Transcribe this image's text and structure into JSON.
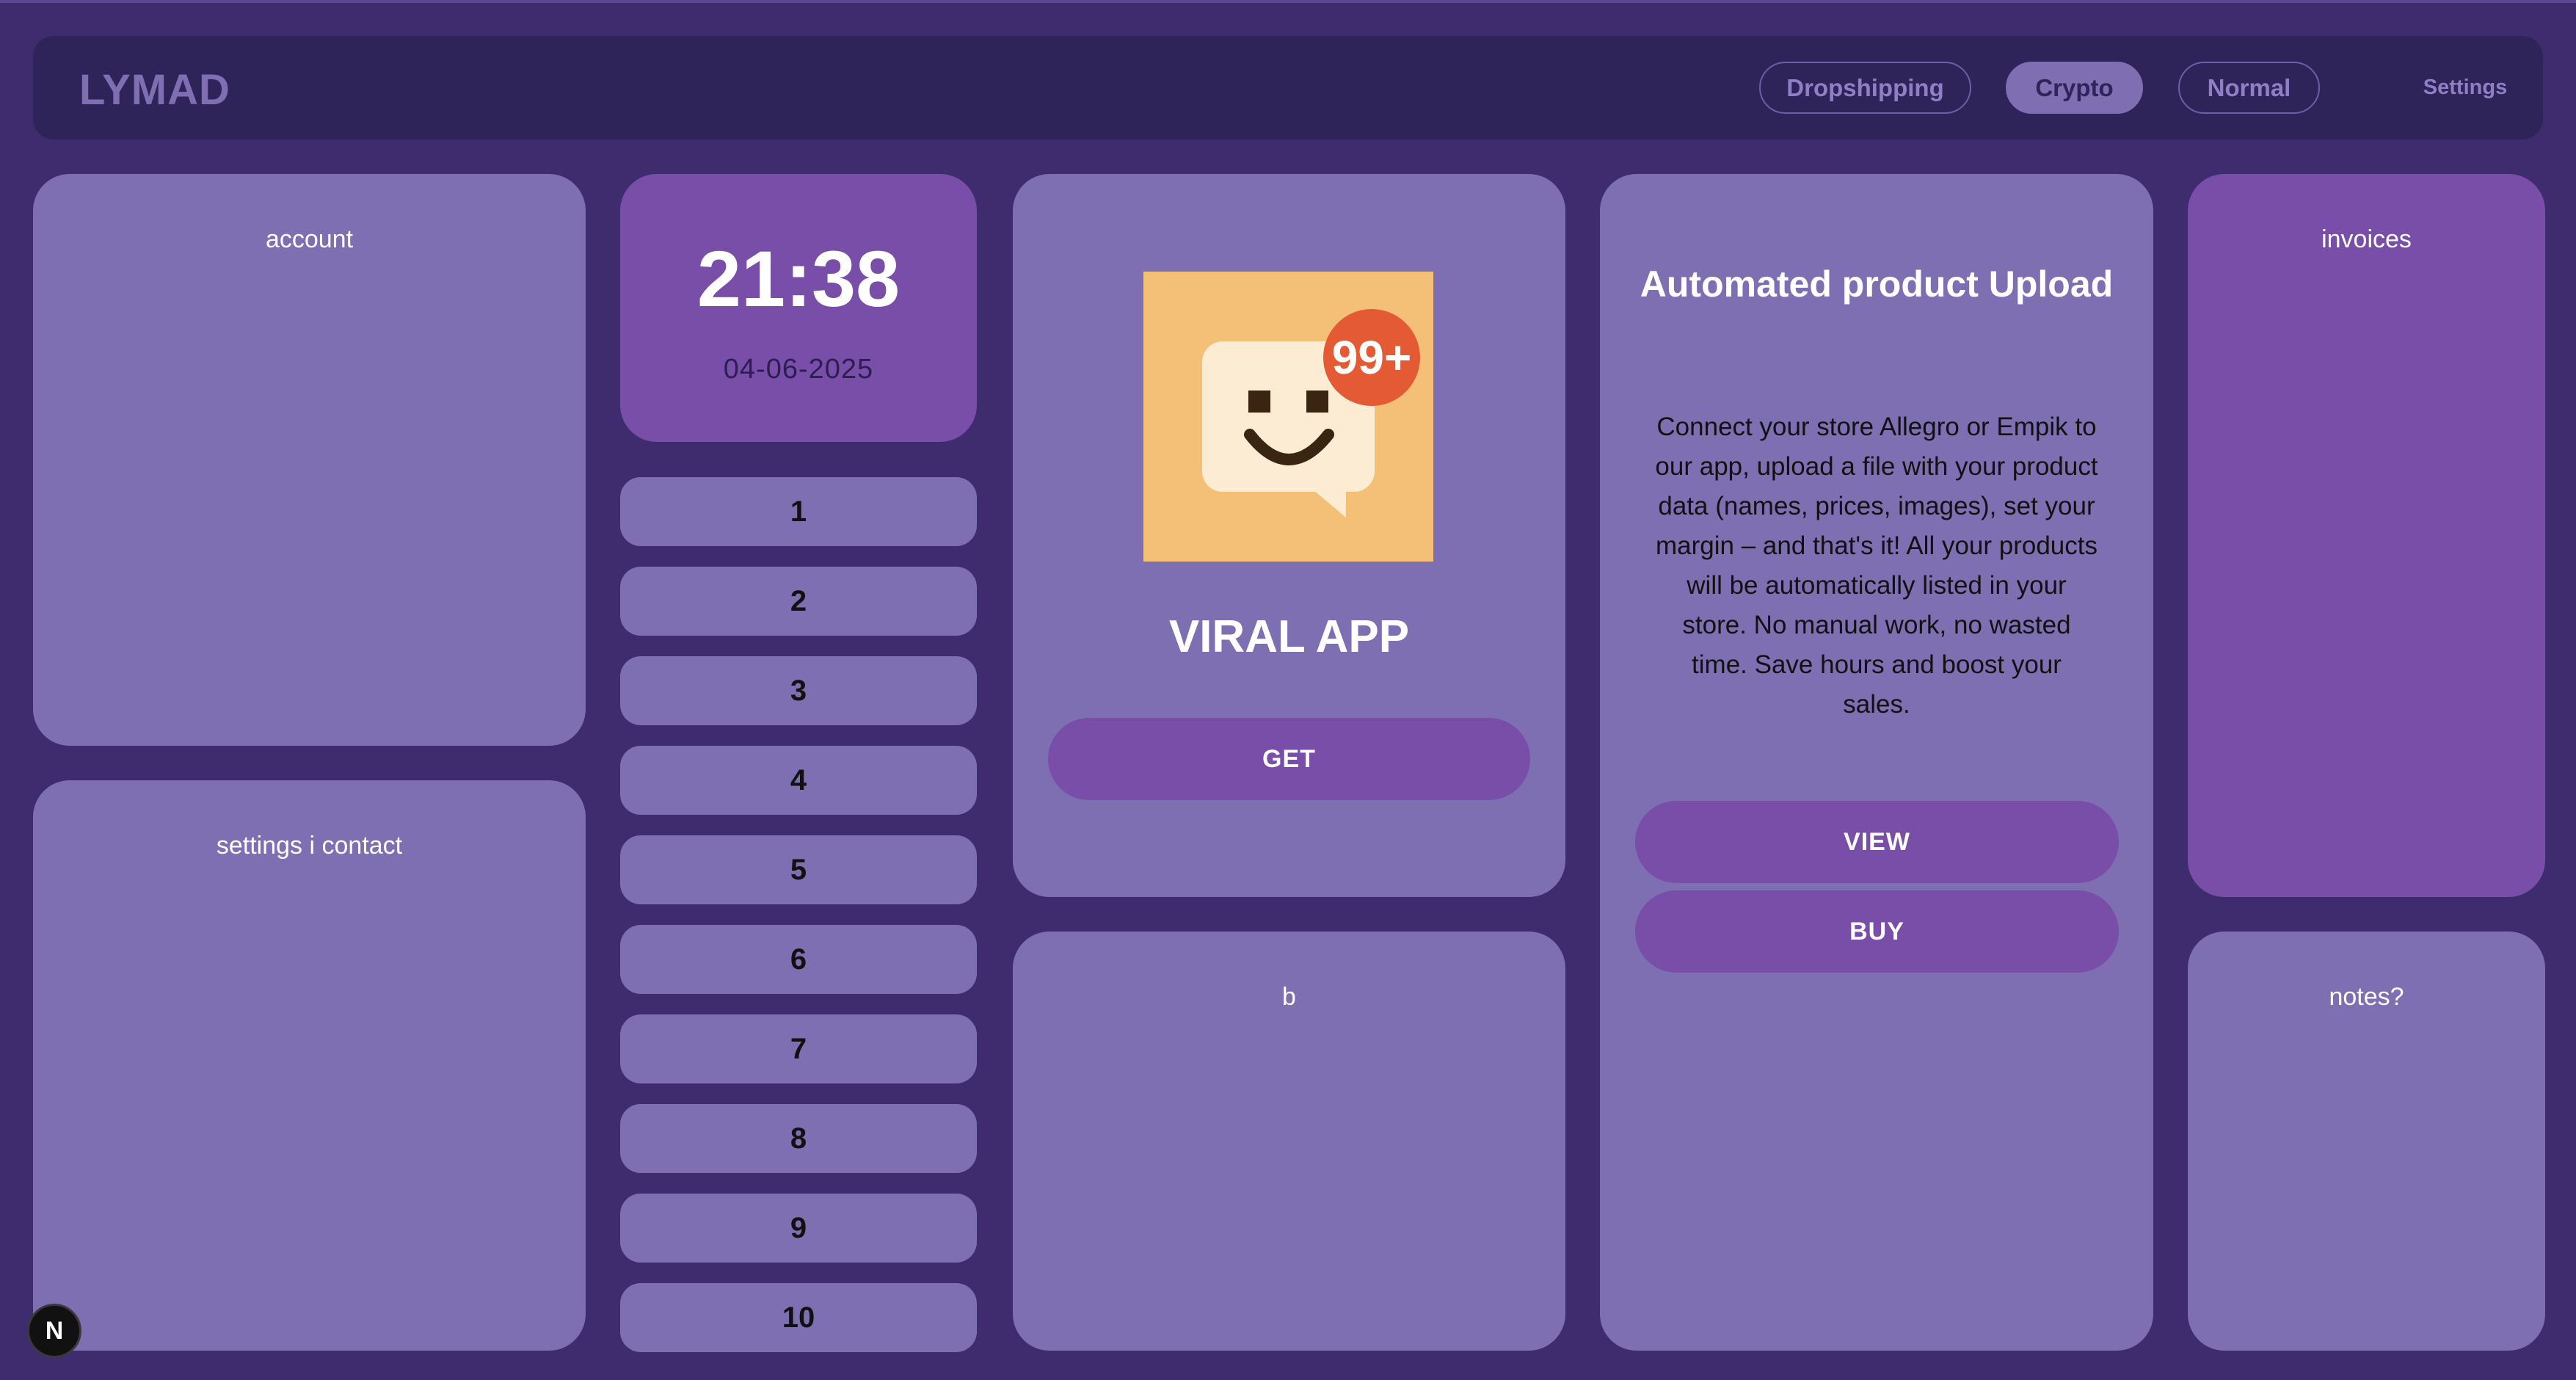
{
  "header": {
    "logo": "LYMAD",
    "nav": [
      {
        "label": "Dropshipping",
        "active": false
      },
      {
        "label": "Crypto",
        "active": true
      },
      {
        "label": "Normal",
        "active": false
      }
    ],
    "settings_label": "Settings"
  },
  "panels": {
    "account": "account",
    "settings_contact": "settings i contact",
    "b": "b",
    "invoices": "invoices",
    "notes": "notes?"
  },
  "clock": {
    "time": "21:38",
    "date": "04-06-2025"
  },
  "number_buttons": [
    "1",
    "2",
    "3",
    "4",
    "5",
    "6",
    "7",
    "8",
    "9",
    "10"
  ],
  "viral_app": {
    "icon": "smiley-chat-icon",
    "badge": "99+",
    "title": "VIRAL APP",
    "get_label": "GET"
  },
  "automated_upload": {
    "title": "Automated product Upload",
    "description": "Connect your store Allegro or Empik to our app, upload a file with your product data (names, prices, images), set your margin – and that's it! All your products will be automatically listed in your store. No manual work, no wasted time. Save hours and boost your sales.",
    "view_label": "VIEW",
    "buy_label": "BUY"
  },
  "dev_badge": "N",
  "colors": {
    "background": "#3f2c6f",
    "navbar": "#2f2459",
    "card": "#7e6fb3",
    "card_dark": "#784ea8",
    "app_icon_bg": "#f4c078",
    "badge": "#e35a35"
  }
}
